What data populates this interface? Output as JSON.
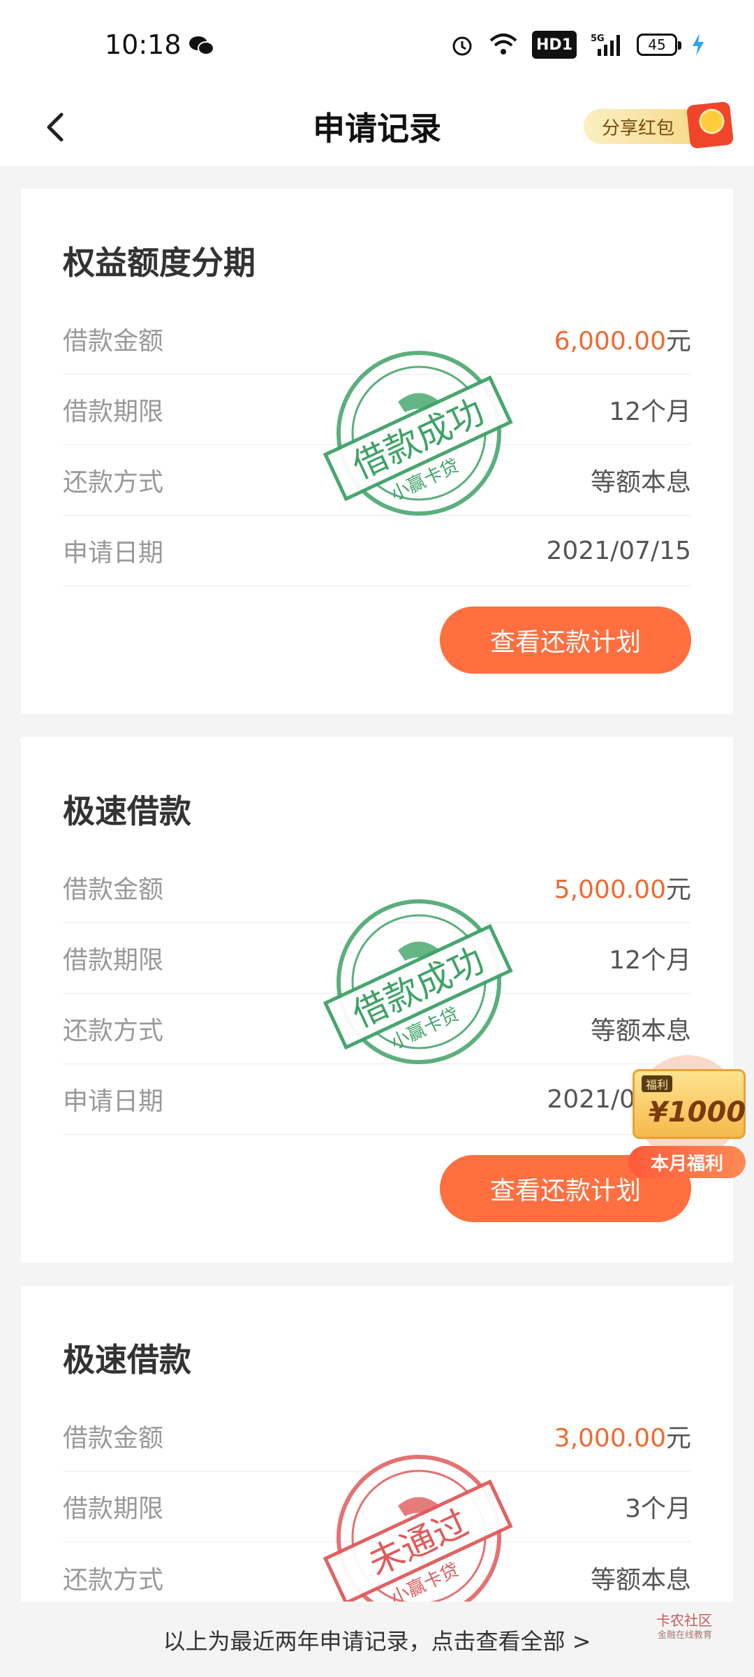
{
  "status_bar": {
    "time": "10:18",
    "battery": "45",
    "network": "5G",
    "hd": "HD1",
    "icons": [
      "wechat-icon",
      "alarm-icon",
      "wifi-icon",
      "signal-icon",
      "battery-icon",
      "charging-icon"
    ]
  },
  "header": {
    "title": "申请记录",
    "share_label": "分享红包",
    "back_icon": "chevron-left-icon"
  },
  "labels": {
    "amount": "借款金额",
    "term": "借款期限",
    "method": "还款方式",
    "date": "申请日期",
    "yuan": "元",
    "plan_button": "查看还款计划"
  },
  "records": [
    {
      "title": "权益额度分期",
      "amount": "6,000.00",
      "term": "12个月",
      "method": "等额本息",
      "date": "2021/07/15",
      "stamp_text": "借款成功",
      "stamp_brand": "小赢卡贷",
      "stamp_color": "#3fa267"
    },
    {
      "title": "极速借款",
      "amount": "5,000.00",
      "term": "12个月",
      "method": "等额本息",
      "date": "2021/0",
      "stamp_text": "借款成功",
      "stamp_brand": "小赢卡贷",
      "stamp_color": "#3fa267"
    },
    {
      "title": "极速借款",
      "amount": "3,000.00",
      "term": "3个月",
      "method": "等额本息",
      "stamp_text": "未通过",
      "stamp_brand": "小赢卡贷",
      "stamp_color": "#e05a5a"
    }
  ],
  "welfare": {
    "tag": "福利",
    "amount": "¥1000",
    "label": "本月福利"
  },
  "footer": {
    "text": "以上为最近两年申请记录，点击查看全部 >",
    "watermark_title": "卡农社区",
    "watermark_sub": "金融在线教育"
  },
  "colors": {
    "accent": "#ff6f3f",
    "amount": "#ee6a33",
    "success_stamp": "#3fa267",
    "fail_stamp": "#e05a5a"
  }
}
